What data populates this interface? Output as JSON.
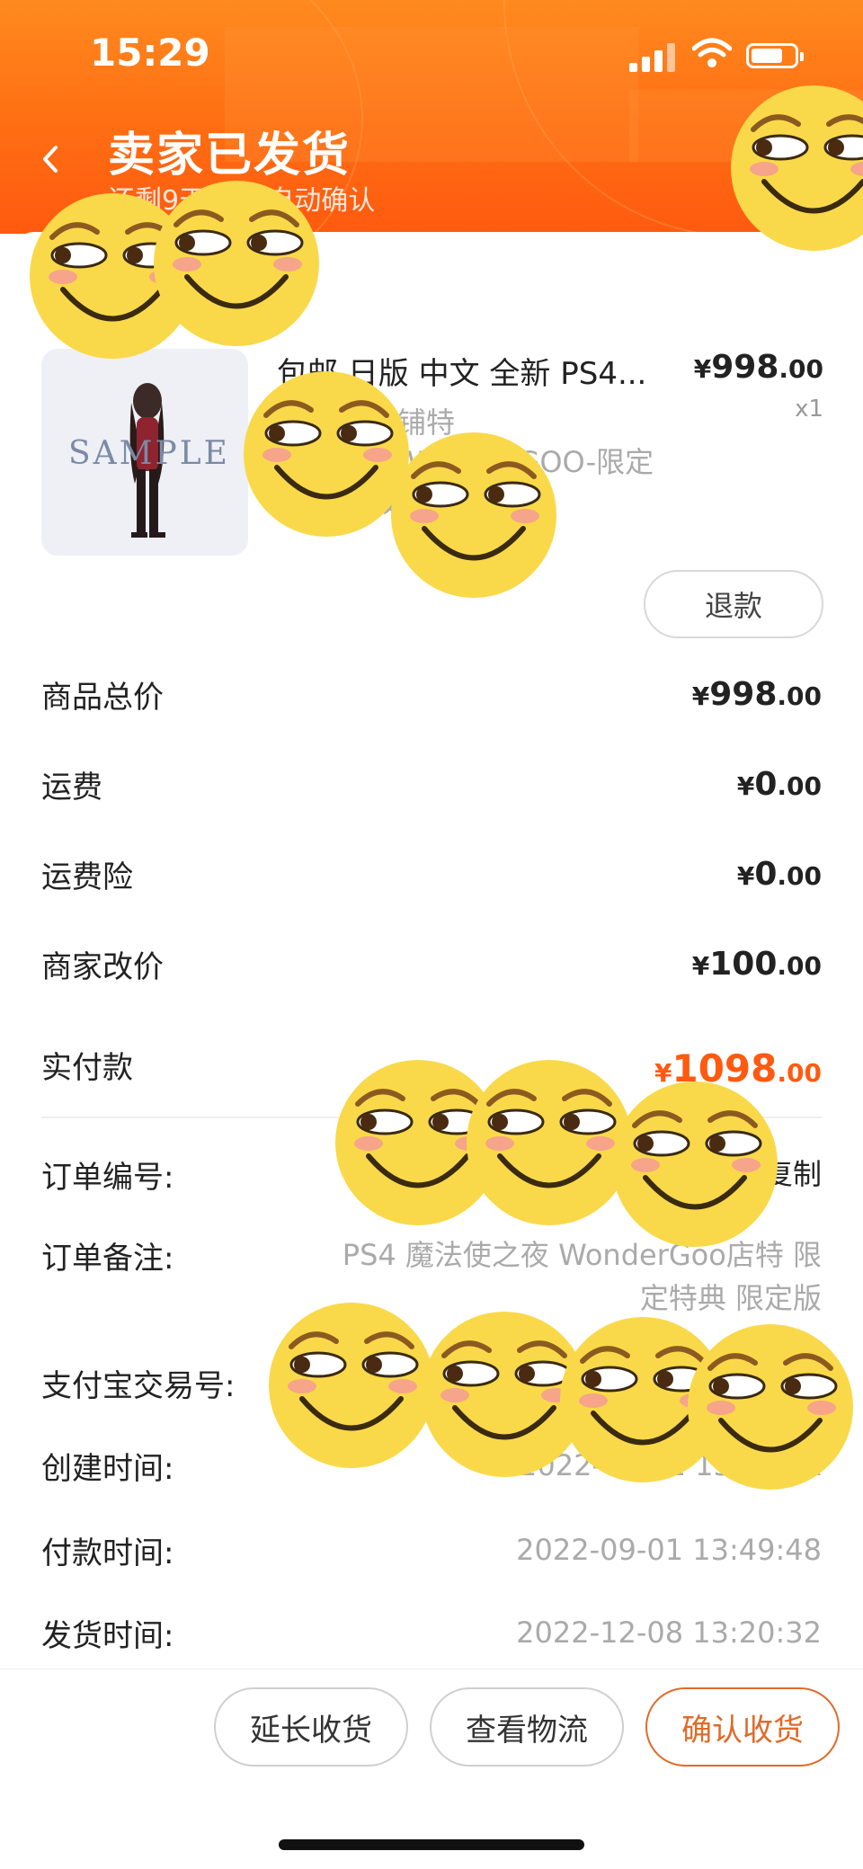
{
  "status_bar": {
    "time": "15:29"
  },
  "header": {
    "title": "卖家已发货",
    "subtitle": "还剩9天16时自动确认"
  },
  "product": {
    "name": "包邮 日版 中文 全新 PS4...",
    "spec": "店铺特典:WonderGOO-限定版 1098",
    "price_symbol": "¥",
    "price_int": "998",
    "price_dec": ".00",
    "quantity": "x1",
    "thumb_watermark": "SAMPLE",
    "refund_label": "退款"
  },
  "summary": [
    {
      "label": "商品总价",
      "symbol": "¥",
      "int": "998",
      "dec": ".00"
    },
    {
      "label": "运费",
      "symbol": "¥",
      "int": "0",
      "dec": ".00"
    },
    {
      "label": "运费险",
      "symbol": "¥",
      "int": "0",
      "dec": ".00"
    },
    {
      "label": "商家改价",
      "symbol": "¥",
      "int": "100",
      "dec": ".00"
    },
    {
      "label": "实付款",
      "symbol": "¥",
      "int": "1098",
      "dec": ".00"
    }
  ],
  "info": {
    "order_no_label": "订单编号:",
    "copy_label": "复制",
    "note_label": "订单备注:",
    "note_line1": "PS4 魔法使之夜 WonderGoo店特 限",
    "note_line2": "定特典 限定版",
    "alipay_label": "支付宝交易号:",
    "created_label": "创建时间:",
    "created_value": "2022-09-01 13:49:xx",
    "paid_label": "付款时间:",
    "paid_value": "2022-09-01 13:49:48",
    "shipped_label": "发货时间:",
    "shipped_value": "2022-12-08 13:20:32"
  },
  "actions": {
    "extend": "延长收货",
    "logistics": "查看物流",
    "confirm": "确认收货"
  },
  "colors": {
    "accent": "#ff5a10",
    "header": "#ff7418",
    "confirm": "#e06a28"
  }
}
